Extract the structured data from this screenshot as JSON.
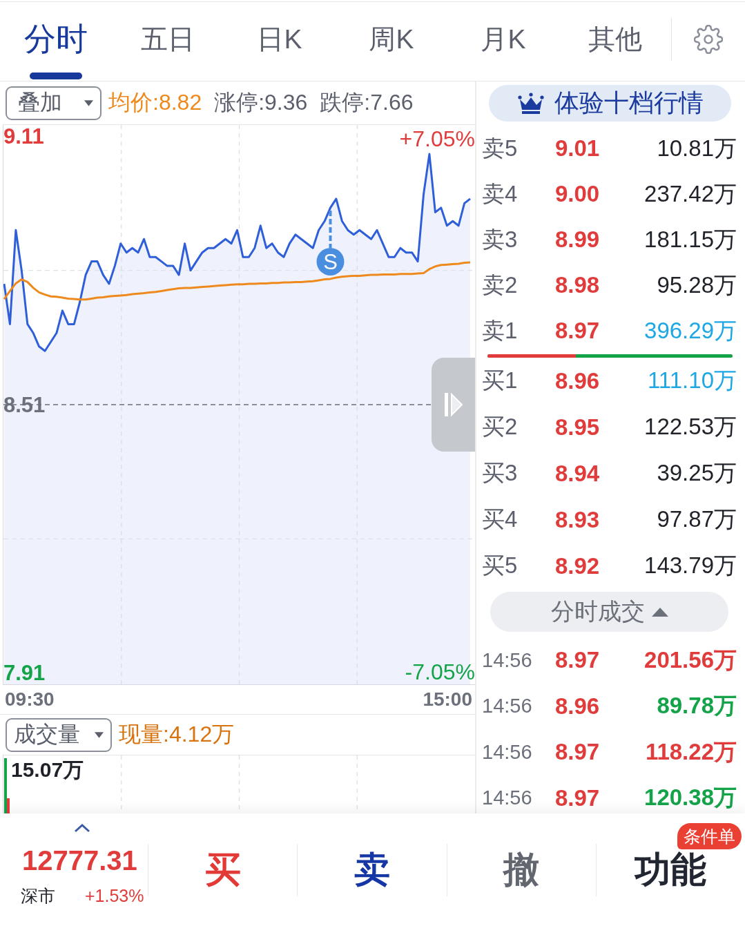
{
  "tabs": [
    {
      "label": "分时",
      "selected": true
    },
    {
      "label": "五日",
      "selected": false
    },
    {
      "label": "日K",
      "selected": false
    },
    {
      "label": "周K",
      "selected": false
    },
    {
      "label": "月K",
      "selected": false
    },
    {
      "label": "其他",
      "selected": false
    }
  ],
  "price_panel": {
    "overlay_select": "叠加",
    "stats": [
      {
        "kind": "avg",
        "text": "均价:8.82"
      },
      {
        "kind": "limit",
        "text": "涨停:9.36"
      },
      {
        "kind": "limit",
        "text": "跌停:7.66"
      }
    ],
    "chart_data": {
      "type": "line",
      "grid": true,
      "ylim": [
        7.885,
        9.135
      ],
      "yticks": [
        {
          "value": 7.91,
          "label": "7.91"
        },
        {
          "value": 8.51,
          "label": "8.51"
        },
        {
          "value": 9.11,
          "label": "9.11"
        }
      ],
      "ref_lines": [
        {
          "axis": "y",
          "value": 8.81,
          "color": "#dde2e8"
        },
        {
          "axis": "y",
          "value": 8.51,
          "color": "#6b6f77"
        },
        {
          "axis": "y",
          "value": 8.21,
          "color": "#dde2e8"
        }
      ],
      "series": [
        {
          "type": "area",
          "color": "#2f5fd8",
          "values": [
            8.78,
            8.69,
            8.9,
            8.81,
            8.69,
            8.67,
            8.64,
            8.63,
            8.65,
            8.67,
            8.72,
            8.69,
            8.69,
            8.74,
            8.8,
            8.83,
            8.83,
            8.8,
            8.78,
            8.82,
            8.87,
            8.85,
            8.86,
            8.85,
            8.88,
            8.84,
            8.84,
            8.83,
            8.82,
            8.82,
            8.8,
            8.87,
            8.81,
            8.83,
            8.85,
            8.86,
            8.86,
            8.87,
            8.88,
            8.87,
            8.9,
            8.84,
            8.84,
            8.86,
            8.91,
            8.86,
            8.87,
            8.85,
            8.84,
            8.87,
            8.89,
            8.88,
            8.87,
            8.86,
            8.9,
            8.92,
            8.95,
            8.97,
            8.92,
            8.9,
            8.89,
            8.9,
            8.89,
            8.88,
            8.9,
            8.87,
            8.84,
            8.84,
            8.86,
            8.85,
            8.85,
            8.83,
            8.98,
            9.07,
            8.94,
            8.95,
            8.91,
            8.92,
            8.91,
            8.96,
            8.97
          ]
        },
        {
          "color": "#ee8a1d",
          "values": [
            8.746,
            8.764,
            8.781,
            8.79,
            8.784,
            8.771,
            8.761,
            8.756,
            8.752,
            8.751,
            8.749,
            8.747,
            8.746,
            8.745,
            8.745,
            8.747,
            8.749,
            8.75,
            8.752,
            8.753,
            8.754,
            8.755,
            8.757,
            8.758,
            8.759,
            8.761,
            8.762,
            8.764,
            8.766,
            8.768,
            8.77,
            8.771,
            8.771,
            8.772,
            8.773,
            8.774,
            8.775,
            8.776,
            8.777,
            8.778,
            8.779,
            8.779,
            8.78,
            8.78,
            8.781,
            8.781,
            8.782,
            8.782,
            8.783,
            8.783,
            8.784,
            8.784,
            8.785,
            8.786,
            8.788,
            8.79,
            8.791,
            8.794,
            8.796,
            8.797,
            8.798,
            8.798,
            8.799,
            8.8,
            8.8,
            8.801,
            8.801,
            8.801,
            8.802,
            8.802,
            8.802,
            8.803,
            8.804,
            8.813,
            8.819,
            8.822,
            8.823,
            8.824,
            8.825,
            8.827,
            8.828
          ]
        }
      ],
      "annotations": [
        "S"
      ]
    },
    "pct_labels": {
      "upper": "+7.05%",
      "lower": "-7.05%"
    },
    "time_labels": [
      "09:30",
      "15:00"
    ]
  },
  "volume_panel": {
    "select": "成交量",
    "current": "现量:4.12万",
    "max_label": "15.07万"
  },
  "quote_panel": {
    "level2_button": "体验十档行情",
    "asks": [
      {
        "label": "卖5",
        "price": "9.01",
        "volume": "10.81万",
        "highlighted": false
      },
      {
        "label": "卖4",
        "price": "9.00",
        "volume": "237.42万",
        "highlighted": false
      },
      {
        "label": "卖3",
        "price": "8.99",
        "volume": "181.15万",
        "highlighted": false
      },
      {
        "label": "卖2",
        "price": "8.98",
        "volume": "95.28万",
        "highlighted": false
      },
      {
        "label": "卖1",
        "price": "8.97",
        "volume": "396.29万",
        "highlighted": true
      }
    ],
    "ratio_bar": {
      "level": 0.36
    },
    "bids": [
      {
        "label": "买1",
        "price": "8.96",
        "volume": "111.10万",
        "highlighted": true
      },
      {
        "label": "买2",
        "price": "8.95",
        "volume": "122.53万",
        "highlighted": false
      },
      {
        "label": "买3",
        "price": "8.94",
        "volume": "39.25万",
        "highlighted": false
      },
      {
        "label": "买4",
        "price": "8.93",
        "volume": "97.87万",
        "highlighted": false
      },
      {
        "label": "买5",
        "price": "8.92",
        "volume": "143.79万",
        "highlighted": false
      }
    ],
    "trades_button": "分时成交",
    "trades": [
      {
        "time": "14:56",
        "price": "8.97",
        "volume": "201.56万",
        "color": "#e03c3c"
      },
      {
        "time": "14:56",
        "price": "8.96",
        "volume": "89.78万",
        "color": "#15a34a"
      },
      {
        "time": "14:56",
        "price": "8.97",
        "volume": "118.22万",
        "color": "#e03c3c"
      },
      {
        "time": "14:56",
        "price": "8.97",
        "volume": "120.38万",
        "color": "#15a34a"
      }
    ]
  },
  "bottom_bar": {
    "index_value": "12777.31",
    "market": "深市",
    "change": "+1.53%",
    "actions": [
      {
        "kind": "buy",
        "label": "买"
      },
      {
        "kind": "sell",
        "label": "卖"
      },
      {
        "kind": "cancel",
        "label": "撤"
      },
      {
        "kind": "more",
        "label": "功能",
        "badge": "条件单"
      }
    ]
  }
}
